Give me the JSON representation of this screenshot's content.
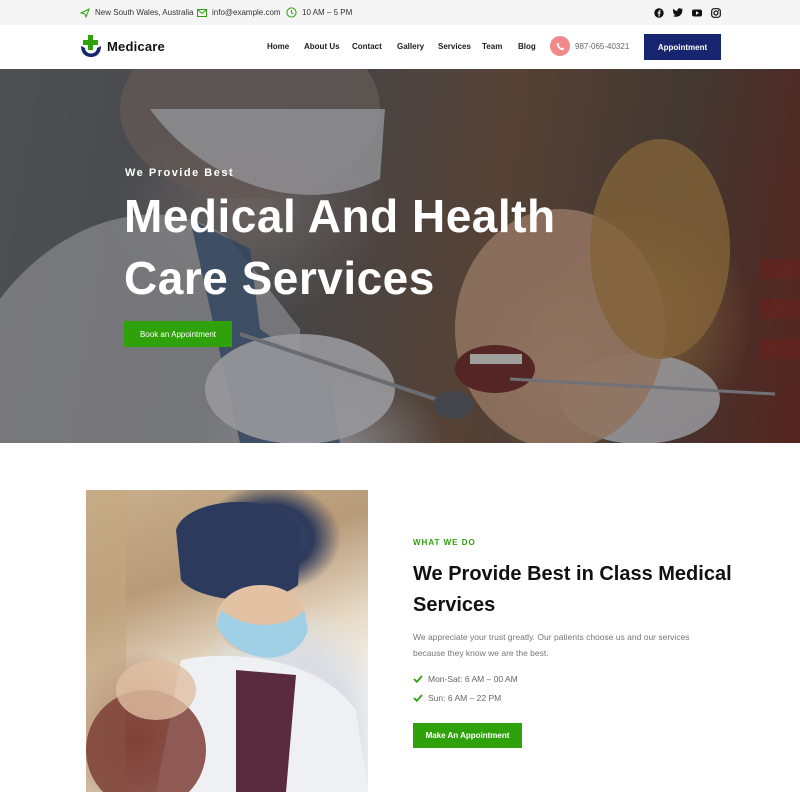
{
  "topbar": {
    "location": "New South Wales, Australia",
    "email": "info@example.com",
    "hours": "10 AM – 5 PM",
    "social": [
      "facebook-icon",
      "twitter-icon",
      "youtube-icon",
      "instagram-icon"
    ]
  },
  "header": {
    "logo_text": "Medicare",
    "nav": [
      "Home",
      "About Us",
      "Contact",
      "Gallery",
      "Services",
      "Team",
      "Blog"
    ],
    "phone": "987-065-40321",
    "appointment_label": "Appointment"
  },
  "hero": {
    "subtitle": "We Provide Best",
    "title": "Medical And Health Care Services",
    "button_label": "Book an Appointment"
  },
  "about": {
    "label": "WHAT WE DO",
    "title": "We Provide Best in Class Medical Services",
    "text": "We appreciate your trust greatly. Our patients choose us and our services because they know we are the best.",
    "hours": [
      "Mon-Sat: 6 AM – 00 AM",
      "Sun: 6 AM – 22 PM"
    ],
    "button_label": "Make An Appointment"
  },
  "colors": {
    "accent_green": "#2fa10a",
    "navy": "#17246e",
    "phone_pink": "#f08a8a"
  }
}
